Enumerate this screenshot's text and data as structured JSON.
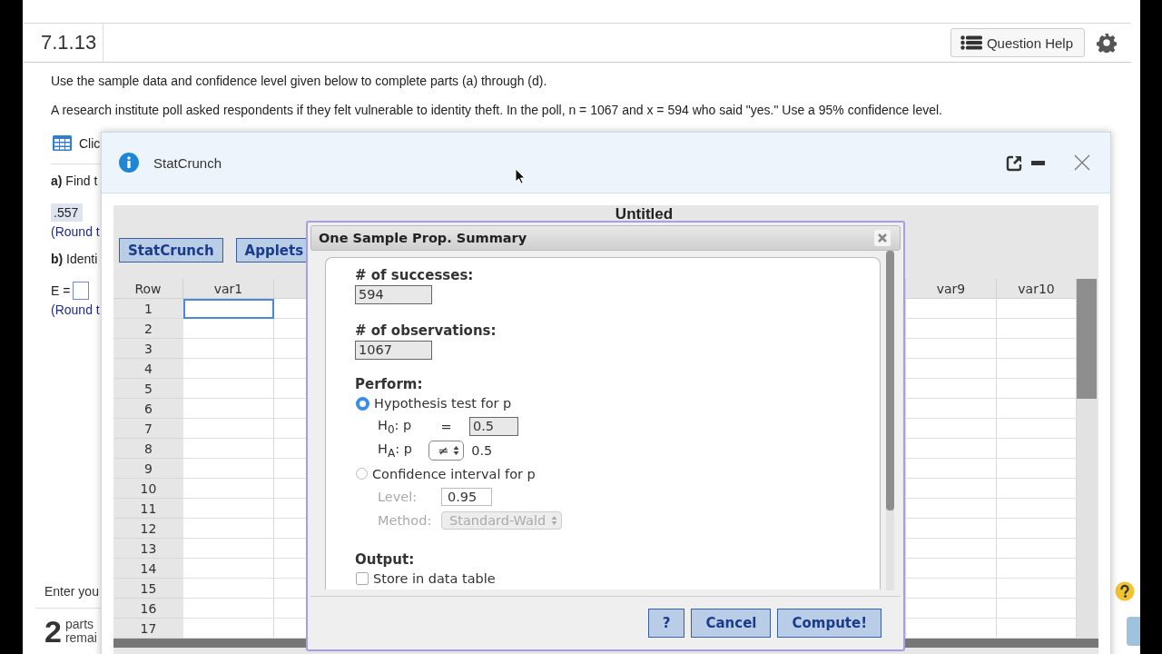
{
  "header": {
    "number": "7.1.13",
    "help_button": "Question Help"
  },
  "instructions": [
    "Use the sample data and confidence level given below to complete parts (a) through (d).",
    "A research institute poll asked respondents if they felt vulnerable to identity theft. In the poll, n = 1067 and x = 594 who said \"yes.\" Use a 95% confidence level."
  ],
  "question": {
    "tool_link": "Clic",
    "part_a": "**a)** Find t",
    "answer_a": ".557",
    "hint_a": "(Round t",
    "part_b": "**b)** Identi",
    "e_label": "E =",
    "hint_b": "(Round t"
  },
  "footer": {
    "prompt": "Enter you",
    "parts_count": "2",
    "parts_word": "parts",
    "remaining_word": "remai"
  },
  "statcrunch": {
    "title": "StatCrunch",
    "sheet_title": "Untitled",
    "buttons": [
      "StatCrunch",
      "Applets"
    ],
    "columns": [
      "Row",
      "var1",
      "var9",
      "var10"
    ],
    "rows": [
      {
        "label": "1",
        "selected": true
      },
      {
        "label": "2",
        "selected": false
      },
      {
        "label": "3",
        "selected": false
      },
      {
        "label": "4",
        "selected": false
      },
      {
        "label": "5",
        "selected": false
      },
      {
        "label": "6",
        "selected": false
      },
      {
        "label": "7",
        "selected": false
      },
      {
        "label": "8",
        "selected": false
      },
      {
        "label": "9",
        "selected": false
      },
      {
        "label": "10",
        "selected": false
      },
      {
        "label": "11",
        "selected": false
      },
      {
        "label": "12",
        "selected": false
      },
      {
        "label": "13",
        "selected": false
      },
      {
        "label": "14",
        "selected": false
      },
      {
        "label": "15",
        "selected": false
      },
      {
        "label": "16",
        "selected": false
      },
      {
        "label": "17",
        "selected": false
      }
    ]
  },
  "dialog": {
    "title": "One Sample Prop. Summary",
    "successes_label": "# of successes:",
    "successes_value": "594",
    "observations_label": "# of observations:",
    "observations_value": "1067",
    "perform_label": "Perform:",
    "options": [
      {
        "label": "Hypothesis test for p",
        "selected": true
      },
      {
        "label": "Confidence interval for p",
        "selected": false
      }
    ],
    "h0": {
      "label": "H$_{0}$: p",
      "operator": "=",
      "value": "0.5"
    },
    "ha": {
      "label": "H$_{A}$: p",
      "operator": "≠",
      "value": "0.5"
    },
    "level_label": "Level:",
    "level_value": "0.95",
    "method_label": "Method:",
    "method_value": "Standard-Wald",
    "output_label": "Output:",
    "store": {
      "label": "Store in data table",
      "checked": false
    },
    "buttons": [
      "?",
      "Cancel",
      "Compute!"
    ]
  }
}
